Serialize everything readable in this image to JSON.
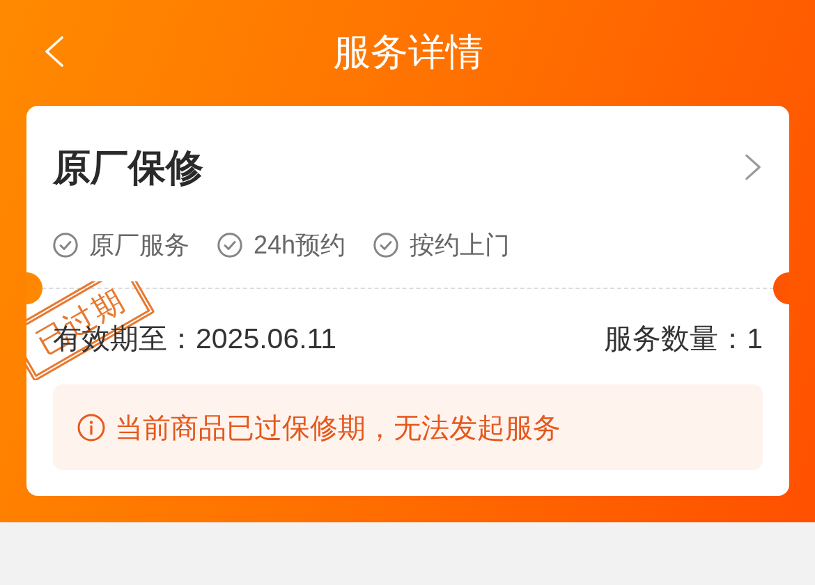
{
  "header": {
    "title": "服务详情"
  },
  "service": {
    "title": "原厂保修",
    "features": [
      {
        "label": "原厂服务"
      },
      {
        "label": "24h预约"
      },
      {
        "label": "按约上门"
      }
    ],
    "stamp": "已过期",
    "validity": "有效期至：2025.06.11",
    "quantity": "服务数量：1",
    "warning": "当前商品已过保修期，无法发起服务"
  }
}
